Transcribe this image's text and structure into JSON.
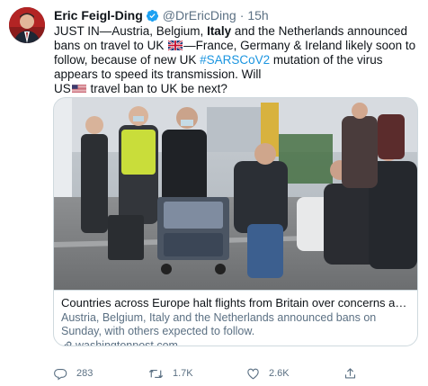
{
  "author": {
    "name": "Eric Feigl-Ding",
    "handle": "@DrEricDing",
    "separator": "·",
    "time": "15h"
  },
  "tweet": {
    "seg1": "JUST IN—Austria, Belgium, ",
    "seg2_bold": "Italy",
    "seg3": " and the Netherlands announced bans on travel to UK ",
    "seg4": "—France, Germany & Ireland likely soon to follow, because of new UK ",
    "hashtag": "#SARSCoV2",
    "seg5": " mutation of the virus appears to speed its transmission. Will",
    "seg6": "US",
    "seg7": " travel ban to UK be next?",
    "flag_uk": "uk-flag-icon",
    "flag_us": "us-flag-icon"
  },
  "card": {
    "title": "Countries across Europe halt flights from Britain over concerns about co...",
    "description": "Austria, Belgium, Italy and the Netherlands announced bans on Sunday, with others expected to follow.",
    "domain": "washingtonpost.com"
  },
  "actions": {
    "replies": "283",
    "retweets": "1.7K",
    "likes": "2.6K"
  },
  "colors": {
    "link": "#1b95e0",
    "secondary_text": "#5b7083",
    "border": "#cfd9de"
  }
}
